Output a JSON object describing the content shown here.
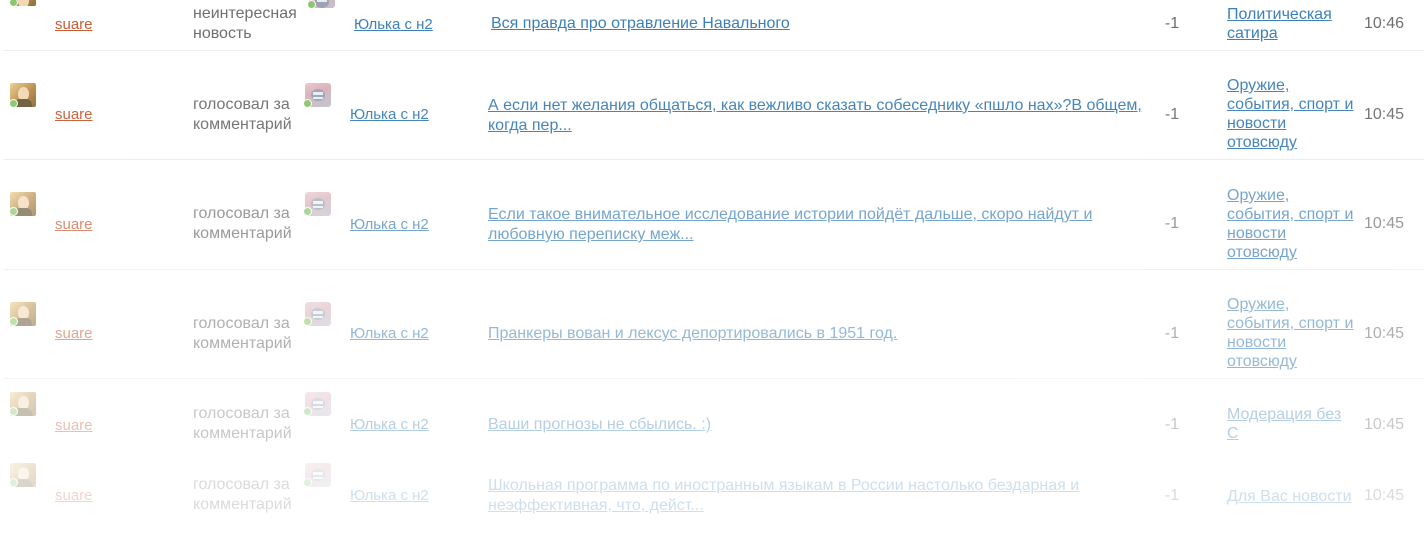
{
  "feed": {
    "rows": [
      {
        "user": "suare",
        "action": "неинтересная новость",
        "target_user": "Юлька с н2",
        "title": "Вся правда про отравление Навального",
        "score": "-1",
        "category": "Политическая сатира",
        "time": "10:46"
      },
      {
        "user": "suare",
        "action": "голосовал за комментарий",
        "target_user": "Юлька с н2",
        "title": "А если нет желания общаться, как вежливо сказать собеседнику «пшло нах»?В общем, когда пер...",
        "score": "-1",
        "category": "Оружие, события, спорт и новости отовсюду",
        "time": "10:45"
      },
      {
        "user": "suare",
        "action": "голосовал за комментарий",
        "target_user": "Юлька с н2",
        "title": "Если такое внимательное исследование истории пойдёт дальше, скоро найдут и любовную переписку меж...",
        "score": "-1",
        "category": "Оружие, события, спорт и новости отовсюду",
        "time": "10:45"
      },
      {
        "user": "suare",
        "action": "голосовал за комментарий",
        "target_user": "Юлька с н2",
        "title": "Пранкеры вован и лексус депортировались в 1951 год.",
        "score": "-1",
        "category": "Оружие, события, спорт и новости отовсюду",
        "time": "10:45"
      },
      {
        "user": "suare",
        "action": "голосовал за комментарий",
        "target_user": "Юлька с н2",
        "title": "Ваши прогнозы не сбылись. :)",
        "score": "-1",
        "category": "Модерация без С",
        "time": "10:45"
      },
      {
        "user": "suare",
        "action": "голосовал за комментарий",
        "target_user": "Юлька с н2",
        "title": "Школьная программа по иностранным языкам в России настолько бездарная и неэффективная, что, дейст...",
        "score": "-1",
        "category": "Для Вас новости",
        "time": "10:45"
      }
    ]
  },
  "colors": {
    "user_link": "#c85c35",
    "link": "#3d7fb7",
    "text": "#6f6f6f",
    "online": "#8cc66d",
    "divider": "#ececec"
  },
  "icons": {
    "user_avatar": "user-avatar-icon",
    "target_avatar": "cat-avatar-icon",
    "online": "online-dot-icon"
  }
}
